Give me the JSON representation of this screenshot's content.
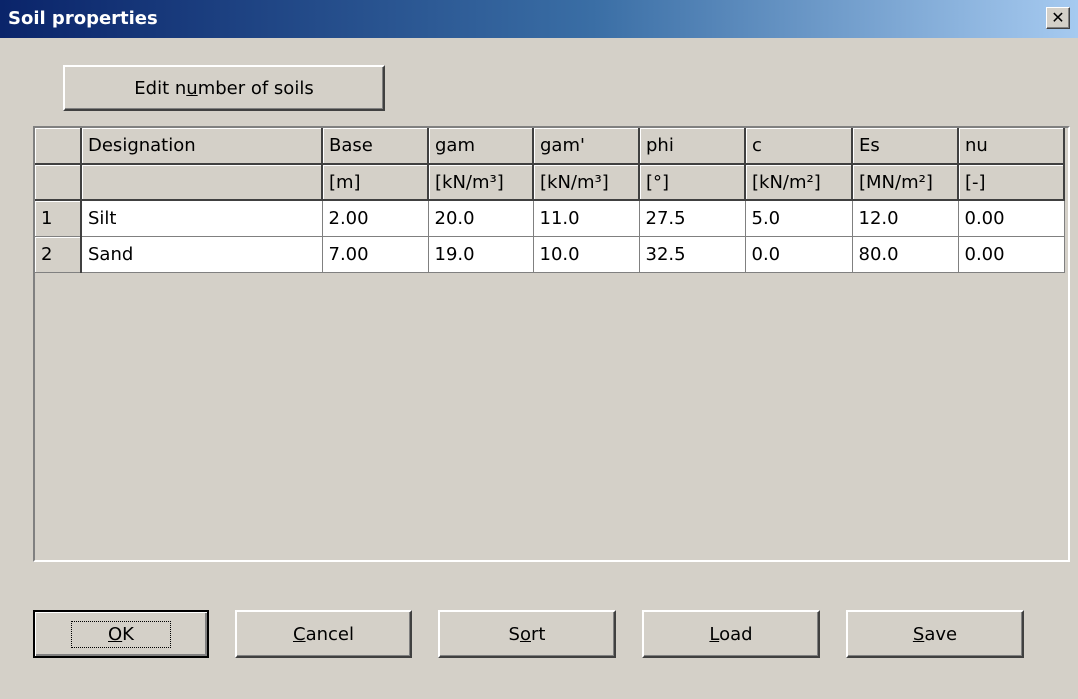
{
  "window": {
    "title": "Soil properties"
  },
  "edit_button": {
    "label_pre": "Edit n",
    "label_ul": "u",
    "label_post": "mber of soils"
  },
  "table": {
    "headers": [
      "Designation",
      "Base",
      "gam",
      "gam'",
      "phi",
      "c",
      "Es",
      "nu"
    ],
    "units": [
      "",
      "[m]",
      "[kN/m³]",
      "[kN/m³]",
      "[°]",
      "[kN/m²]",
      "[MN/m²]",
      "[-]"
    ],
    "rows": [
      {
        "num": "1",
        "cells": [
          "Silt",
          "2.00",
          "20.0",
          "11.0",
          "27.5",
          "5.0",
          "12.0",
          "0.00"
        ]
      },
      {
        "num": "2",
        "cells": [
          "Sand",
          "7.00",
          "19.0",
          "10.0",
          "32.5",
          "0.0",
          "80.0",
          "0.00"
        ]
      }
    ]
  },
  "buttons": {
    "ok": {
      "ul": "O",
      "rest": "K"
    },
    "cancel": {
      "ul": "C",
      "rest": "ancel"
    },
    "sort": {
      "pre": "S",
      "ul": "o",
      "rest": "rt"
    },
    "load": {
      "ul": "L",
      "rest": "oad"
    },
    "save": {
      "ul": "S",
      "rest": "ave"
    }
  }
}
